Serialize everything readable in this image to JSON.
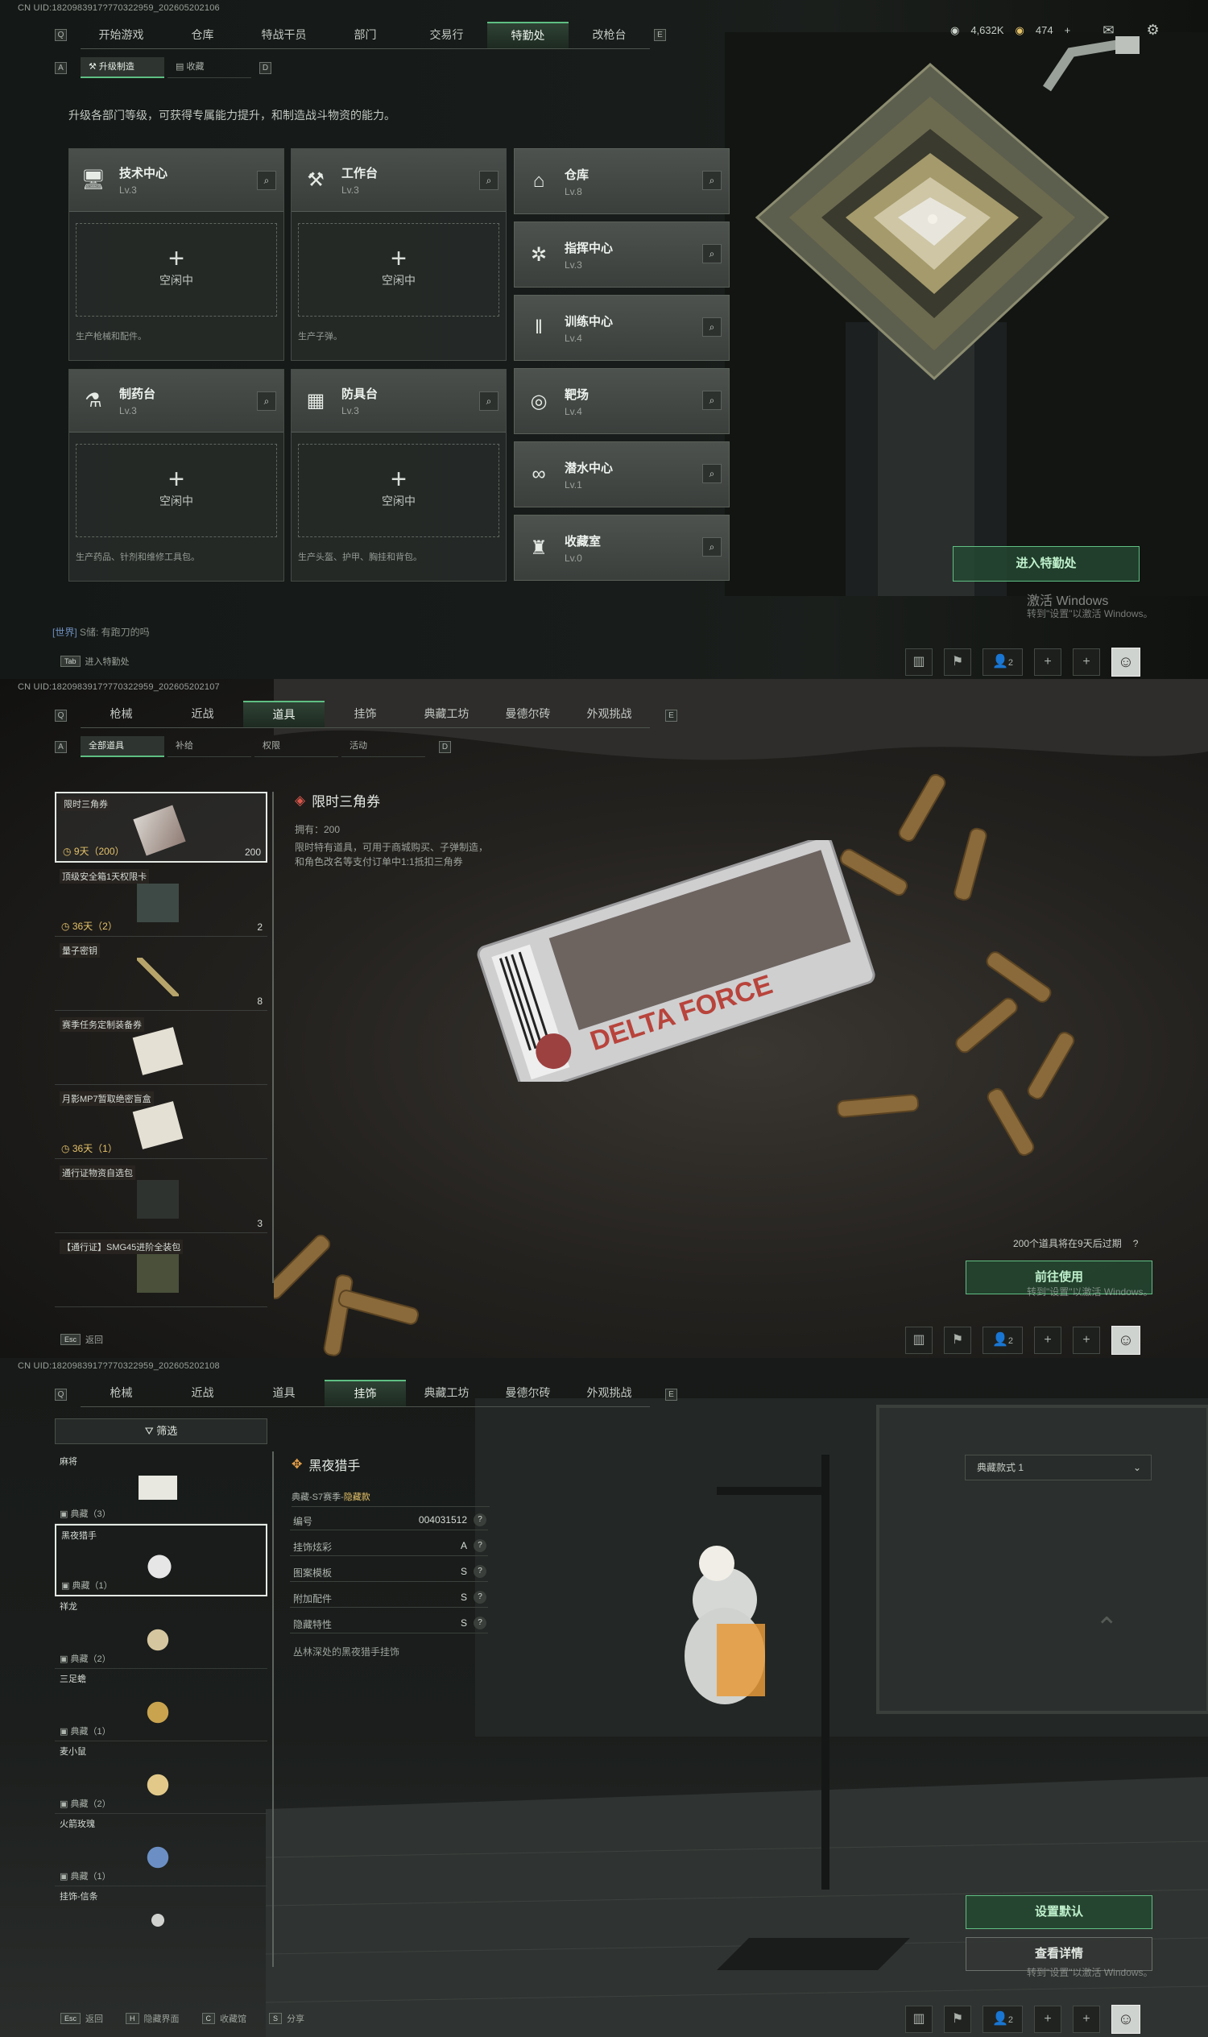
{
  "panel1": {
    "uid": "CN UID:1820983917?770322959_202605202106",
    "nav_key_left": "Q",
    "nav_key_right": "E",
    "tabs": [
      "开始游戏",
      "仓库",
      "特战干员",
      "部门",
      "交易行",
      "特勤处",
      "改枪台"
    ],
    "active_tab": "特勤处",
    "subnav_key_left": "A",
    "subnav_key_right": "D",
    "subtabs": [
      "升级制造",
      "收藏"
    ],
    "currency1": "4,632K",
    "currency2": "474",
    "plus": "+",
    "mail_icon": "mail-icon",
    "settings_icon": "gear-icon",
    "description": "升级各部门等级，可获得专属能力提升，和制造战斗物资的能力。",
    "cards": [
      {
        "name": "技术中心",
        "level": "Lv.3",
        "icon": "monitor-icon",
        "idle": "空闲中",
        "foot": "生产枪械和配件。"
      },
      {
        "name": "工作台",
        "level": "Lv.3",
        "icon": "tools-icon",
        "idle": "空闲中",
        "foot": "生产子弹。"
      },
      {
        "name": "制药台",
        "level": "Lv.3",
        "icon": "flask-icon",
        "idle": "空闲中",
        "foot": "生产药品、针剂和维修工具包。"
      },
      {
        "name": "防具台",
        "level": "Lv.3",
        "icon": "blocks-icon",
        "idle": "空闲中",
        "foot": "生产头盔、护甲、胸挂和背包。"
      }
    ],
    "side_cards": [
      {
        "name": "仓库",
        "level": "Lv.8",
        "icon": "warehouse-icon"
      },
      {
        "name": "指挥中心",
        "level": "Lv.3",
        "icon": "gear-hub-icon"
      },
      {
        "name": "训练中心",
        "level": "Lv.4",
        "icon": "dumbbell-icon"
      },
      {
        "name": "靶场",
        "level": "Lv.4",
        "icon": "target-icon"
      },
      {
        "name": "潜水中心",
        "level": "Lv.1",
        "icon": "diving-icon"
      },
      {
        "name": "收藏室",
        "level": "Lv.0",
        "icon": "trophy-icon"
      }
    ],
    "enter_button": "进入特勤处",
    "watermark_title": "激活 Windows",
    "watermark_sub": "转到\"设置\"以激活 Windows。",
    "chat_channel": "[世界]",
    "chat_text": " S储: 有跑刀的吗",
    "hint_key": "Tab",
    "hint_text": "进入特勤处",
    "friends_count": "2"
  },
  "panel2": {
    "uid": "CN UID:1820983917?770322959_202605202107",
    "tabs": [
      "枪械",
      "近战",
      "道具",
      "挂饰",
      "典藏工坊",
      "曼德尔砖",
      "外观挑战"
    ],
    "active_tab": "道具",
    "subtabs": [
      "全部道具",
      "补给",
      "权限",
      "活动"
    ],
    "items": [
      {
        "name": "限时三角券",
        "time": "9天（200）",
        "count": "200"
      },
      {
        "name": "顶级安全箱1天权限卡",
        "time": "36天（2）",
        "count": "2"
      },
      {
        "name": "量子密钥",
        "time": "",
        "count": "8"
      },
      {
        "name": "赛季任务定制装备券",
        "time": "",
        "count": ""
      },
      {
        "name": "月影MP7暂取绝密盲盒",
        "time": "36天（1）",
        "count": ""
      },
      {
        "name": "通行证物资自选包",
        "time": "",
        "count": "3"
      },
      {
        "name": "【通行证】SMG45进阶全装包",
        "time": "",
        "count": ""
      }
    ],
    "detail_title": "限时三角券",
    "detail_owned": "拥有：200",
    "detail_desc": "限时特有道具，可用于商城购买、子弹制造，和角色改名等支付订单中1:1抵扣三角券",
    "card_brand": "DELTA FORCE",
    "expire_note": "200个道具将在9天后过期",
    "help_glyph": "?",
    "use_button": "前往使用",
    "watermark_title": "激活 Windows",
    "watermark_sub": "转到\"设置\"以激活 Windows。",
    "hint_key": "Esc",
    "hint_text": "返回",
    "friends_count": "2"
  },
  "panel3": {
    "uid": "CN UID:1820983917?770322959_202605202108",
    "tabs": [
      "枪械",
      "近战",
      "道具",
      "挂饰",
      "典藏工坊",
      "曼德尔砖",
      "外观挑战"
    ],
    "active_tab": "挂饰",
    "filter_label": "筛选",
    "items": [
      {
        "name": "麻将",
        "tag": "典藏（3）"
      },
      {
        "name": "黑夜猎手",
        "tag": "典藏（1）"
      },
      {
        "name": "祥龙",
        "tag": "典藏（2）"
      },
      {
        "name": "三足蟾",
        "tag": "典藏（1）"
      },
      {
        "name": "麦小鼠",
        "tag": "典藏（2）"
      },
      {
        "name": "火箭玫瑰",
        "tag": "典藏（1）"
      },
      {
        "name": "挂饰-信条",
        "tag": ""
      }
    ],
    "detail_title": "黑夜猎手",
    "detail_sub_prefix": "典藏-S7赛季-",
    "detail_sub_hidden": "隐藏款",
    "rows": [
      {
        "k": "编号",
        "v": "004031512"
      },
      {
        "k": "挂饰炫彩",
        "v": "A"
      },
      {
        "k": "图案模板",
        "v": "S"
      },
      {
        "k": "附加配件",
        "v": "S"
      },
      {
        "k": "隐藏特性",
        "v": "S"
      }
    ],
    "detail_desc": "丛林深处的黑夜猎手挂饰",
    "style_select": "典藏款式 1",
    "default_button": "设置默认",
    "details_button": "查看详情",
    "watermark_title": "激活 Windows",
    "watermark_sub": "转到\"设置\"以激活 Windows。",
    "hints": [
      {
        "key": "Esc",
        "text": "返回"
      },
      {
        "key": "H",
        "text": "隐藏界面"
      },
      {
        "key": "C",
        "text": "收藏馆"
      },
      {
        "key": "S",
        "text": "分享"
      }
    ],
    "friends_count": "2"
  },
  "colors": {
    "accent_green": "#5fbf83",
    "gold": "#e6c36a",
    "panel": "#262a28"
  }
}
